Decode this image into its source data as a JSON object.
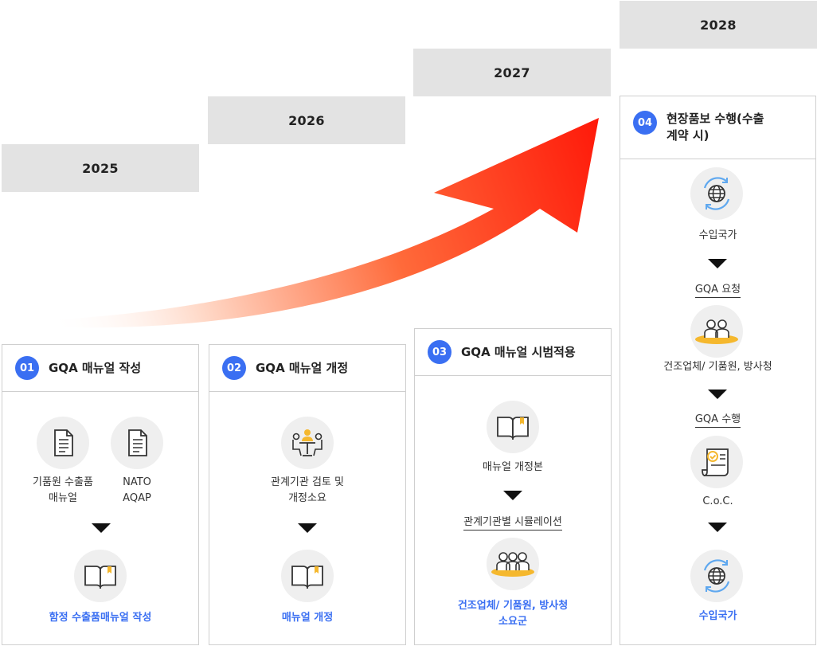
{
  "years": [
    "2025",
    "2026",
    "2027",
    "2028"
  ],
  "card1": {
    "num": "01",
    "title": "GQA 매뉴얼 작성",
    "item_a": "기품원 수출품\n매뉴얼",
    "item_b": "NATO\nAQAP",
    "result": "함정 수출품매뉴얼 작성"
  },
  "card2": {
    "num": "02",
    "title": "GQA 매뉴얼 개정",
    "item": "관계기관 검토 및\n개정소요",
    "result": "매뉴얼 개정"
  },
  "card3": {
    "num": "03",
    "title": "GQA 매뉴얼 시범적용",
    "item": "매뉴얼 개정본",
    "step": "관계기관별 시뮬레이션",
    "result": "건조업체/ 기품원, 방사청\n소요군"
  },
  "card4": {
    "num": "04",
    "title": "현장품보 수행(수출\n계약 시)",
    "item1": "수입국가",
    "step1": "GQA 요청",
    "item2": "건조업체/ 기품원, 방사청",
    "step2": "GQA 수행",
    "item3": "C.o.C.",
    "result": "수입국가"
  },
  "colors": {
    "accent": "#3a6ff2",
    "arrow": "#ff2a10",
    "year_bg": "#e3e3e3"
  }
}
